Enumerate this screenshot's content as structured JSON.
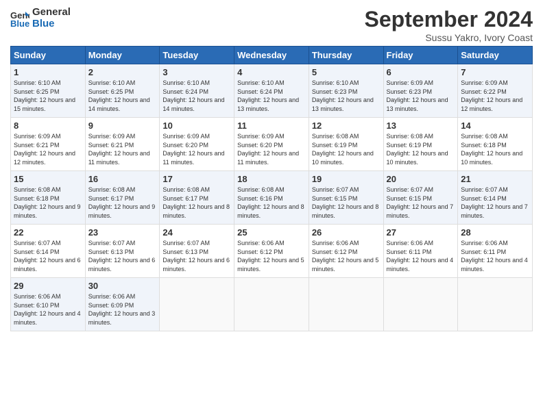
{
  "logo": {
    "line1": "General",
    "line2": "Blue"
  },
  "title": "September 2024",
  "location": "Sussu Yakro, Ivory Coast",
  "weekdays": [
    "Sunday",
    "Monday",
    "Tuesday",
    "Wednesday",
    "Thursday",
    "Friday",
    "Saturday"
  ],
  "weeks": [
    [
      {
        "day": "1",
        "sunrise": "Sunrise: 6:10 AM",
        "sunset": "Sunset: 6:25 PM",
        "daylight": "Daylight: 12 hours and 15 minutes."
      },
      {
        "day": "2",
        "sunrise": "Sunrise: 6:10 AM",
        "sunset": "Sunset: 6:25 PM",
        "daylight": "Daylight: 12 hours and 14 minutes."
      },
      {
        "day": "3",
        "sunrise": "Sunrise: 6:10 AM",
        "sunset": "Sunset: 6:24 PM",
        "daylight": "Daylight: 12 hours and 14 minutes."
      },
      {
        "day": "4",
        "sunrise": "Sunrise: 6:10 AM",
        "sunset": "Sunset: 6:24 PM",
        "daylight": "Daylight: 12 hours and 13 minutes."
      },
      {
        "day": "5",
        "sunrise": "Sunrise: 6:10 AM",
        "sunset": "Sunset: 6:23 PM",
        "daylight": "Daylight: 12 hours and 13 minutes."
      },
      {
        "day": "6",
        "sunrise": "Sunrise: 6:09 AM",
        "sunset": "Sunset: 6:23 PM",
        "daylight": "Daylight: 12 hours and 13 minutes."
      },
      {
        "day": "7",
        "sunrise": "Sunrise: 6:09 AM",
        "sunset": "Sunset: 6:22 PM",
        "daylight": "Daylight: 12 hours and 12 minutes."
      }
    ],
    [
      {
        "day": "8",
        "sunrise": "Sunrise: 6:09 AM",
        "sunset": "Sunset: 6:21 PM",
        "daylight": "Daylight: 12 hours and 12 minutes."
      },
      {
        "day": "9",
        "sunrise": "Sunrise: 6:09 AM",
        "sunset": "Sunset: 6:21 PM",
        "daylight": "Daylight: 12 hours and 11 minutes."
      },
      {
        "day": "10",
        "sunrise": "Sunrise: 6:09 AM",
        "sunset": "Sunset: 6:20 PM",
        "daylight": "Daylight: 12 hours and 11 minutes."
      },
      {
        "day": "11",
        "sunrise": "Sunrise: 6:09 AM",
        "sunset": "Sunset: 6:20 PM",
        "daylight": "Daylight: 12 hours and 11 minutes."
      },
      {
        "day": "12",
        "sunrise": "Sunrise: 6:08 AM",
        "sunset": "Sunset: 6:19 PM",
        "daylight": "Daylight: 12 hours and 10 minutes."
      },
      {
        "day": "13",
        "sunrise": "Sunrise: 6:08 AM",
        "sunset": "Sunset: 6:19 PM",
        "daylight": "Daylight: 12 hours and 10 minutes."
      },
      {
        "day": "14",
        "sunrise": "Sunrise: 6:08 AM",
        "sunset": "Sunset: 6:18 PM",
        "daylight": "Daylight: 12 hours and 10 minutes."
      }
    ],
    [
      {
        "day": "15",
        "sunrise": "Sunrise: 6:08 AM",
        "sunset": "Sunset: 6:18 PM",
        "daylight": "Daylight: 12 hours and 9 minutes."
      },
      {
        "day": "16",
        "sunrise": "Sunrise: 6:08 AM",
        "sunset": "Sunset: 6:17 PM",
        "daylight": "Daylight: 12 hours and 9 minutes."
      },
      {
        "day": "17",
        "sunrise": "Sunrise: 6:08 AM",
        "sunset": "Sunset: 6:17 PM",
        "daylight": "Daylight: 12 hours and 8 minutes."
      },
      {
        "day": "18",
        "sunrise": "Sunrise: 6:08 AM",
        "sunset": "Sunset: 6:16 PM",
        "daylight": "Daylight: 12 hours and 8 minutes."
      },
      {
        "day": "19",
        "sunrise": "Sunrise: 6:07 AM",
        "sunset": "Sunset: 6:15 PM",
        "daylight": "Daylight: 12 hours and 8 minutes."
      },
      {
        "day": "20",
        "sunrise": "Sunrise: 6:07 AM",
        "sunset": "Sunset: 6:15 PM",
        "daylight": "Daylight: 12 hours and 7 minutes."
      },
      {
        "day": "21",
        "sunrise": "Sunrise: 6:07 AM",
        "sunset": "Sunset: 6:14 PM",
        "daylight": "Daylight: 12 hours and 7 minutes."
      }
    ],
    [
      {
        "day": "22",
        "sunrise": "Sunrise: 6:07 AM",
        "sunset": "Sunset: 6:14 PM",
        "daylight": "Daylight: 12 hours and 6 minutes."
      },
      {
        "day": "23",
        "sunrise": "Sunrise: 6:07 AM",
        "sunset": "Sunset: 6:13 PM",
        "daylight": "Daylight: 12 hours and 6 minutes."
      },
      {
        "day": "24",
        "sunrise": "Sunrise: 6:07 AM",
        "sunset": "Sunset: 6:13 PM",
        "daylight": "Daylight: 12 hours and 6 minutes."
      },
      {
        "day": "25",
        "sunrise": "Sunrise: 6:06 AM",
        "sunset": "Sunset: 6:12 PM",
        "daylight": "Daylight: 12 hours and 5 minutes."
      },
      {
        "day": "26",
        "sunrise": "Sunrise: 6:06 AM",
        "sunset": "Sunset: 6:12 PM",
        "daylight": "Daylight: 12 hours and 5 minutes."
      },
      {
        "day": "27",
        "sunrise": "Sunrise: 6:06 AM",
        "sunset": "Sunset: 6:11 PM",
        "daylight": "Daylight: 12 hours and 4 minutes."
      },
      {
        "day": "28",
        "sunrise": "Sunrise: 6:06 AM",
        "sunset": "Sunset: 6:11 PM",
        "daylight": "Daylight: 12 hours and 4 minutes."
      }
    ],
    [
      {
        "day": "29",
        "sunrise": "Sunrise: 6:06 AM",
        "sunset": "Sunset: 6:10 PM",
        "daylight": "Daylight: 12 hours and 4 minutes."
      },
      {
        "day": "30",
        "sunrise": "Sunrise: 6:06 AM",
        "sunset": "Sunset: 6:09 PM",
        "daylight": "Daylight: 12 hours and 3 minutes."
      },
      null,
      null,
      null,
      null,
      null
    ]
  ]
}
